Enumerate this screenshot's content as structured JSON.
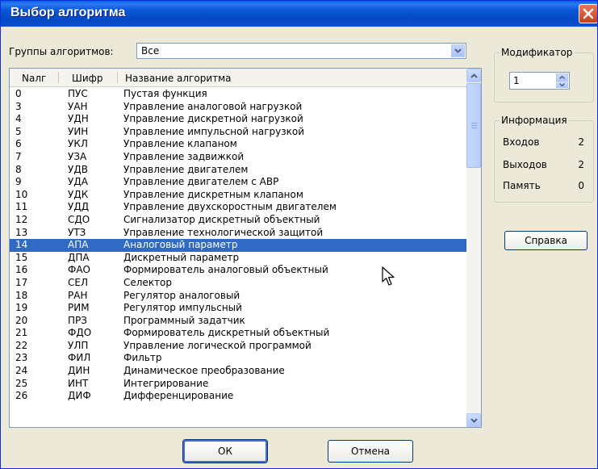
{
  "window": {
    "title": "Выбор алгоритма"
  },
  "groups": {
    "label": "Группы алгоритмов:",
    "selected": "Все"
  },
  "list": {
    "columns": [
      "Nалг",
      "Шифр",
      "Название алгоритма"
    ],
    "rows": [
      {
        "n": "0",
        "code": "ПУС",
        "name": "Пустая функция"
      },
      {
        "n": "3",
        "code": "УАН",
        "name": "Управление аналоговой нагрузкой"
      },
      {
        "n": "4",
        "code": "УДН",
        "name": "Управление дискретной нагрузкой"
      },
      {
        "n": "5",
        "code": "УИН",
        "name": "Управление импульсной нагрузкой"
      },
      {
        "n": "6",
        "code": "УКЛ",
        "name": "Управление клапаном"
      },
      {
        "n": "7",
        "code": "УЗА",
        "name": "Управление задвижкой"
      },
      {
        "n": "8",
        "code": "УДВ",
        "name": "Управление двигателем"
      },
      {
        "n": "9",
        "code": "УДА",
        "name": "Управление двигателем с АВР"
      },
      {
        "n": "10",
        "code": "УДК",
        "name": "Управление дискретным клапаном"
      },
      {
        "n": "11",
        "code": "УДД",
        "name": "Управление двухскоростным двигателем"
      },
      {
        "n": "12",
        "code": "СДО",
        "name": "Сигнализатор дискретный объектный"
      },
      {
        "n": "13",
        "code": "УТЗ",
        "name": "Управление технологической защитой"
      },
      {
        "n": "14",
        "code": "АПА",
        "name": "Аналоговый параметр"
      },
      {
        "n": "15",
        "code": "ДПА",
        "name": "Дискретный параметр"
      },
      {
        "n": "16",
        "code": "ФАО",
        "name": "Формирователь аналоговый объектный"
      },
      {
        "n": "17",
        "code": "СЕЛ",
        "name": "Селектор"
      },
      {
        "n": "18",
        "code": "РАН",
        "name": "Регулятор аналоговый"
      },
      {
        "n": "19",
        "code": "РИМ",
        "name": "Регулятор импульсный"
      },
      {
        "n": "20",
        "code": "ПРЗ",
        "name": "Программный задатчик"
      },
      {
        "n": "21",
        "code": "ФДО",
        "name": "Формирователь дискретный объектный"
      },
      {
        "n": "22",
        "code": "УЛП",
        "name": "Управление логической программой"
      },
      {
        "n": "23",
        "code": "ФИЛ",
        "name": "Фильтр"
      },
      {
        "n": "24",
        "code": "ДИН",
        "name": "Динамическое преобразование"
      },
      {
        "n": "25",
        "code": "ИНТ",
        "name": "Интегрирование"
      },
      {
        "n": "26",
        "code": "ДИФ",
        "name": "Дифференцирование"
      }
    ],
    "selected_n": "14"
  },
  "modifier": {
    "label": "Модификатор",
    "value": "1"
  },
  "info": {
    "label": "Информация",
    "inputs_label": "Входов",
    "inputs_value": "2",
    "outputs_label": "Выходов",
    "outputs_value": "2",
    "memory_label": "Память",
    "memory_value": "0"
  },
  "buttons": {
    "help": "Справка",
    "ok": "ОК",
    "cancel": "Отмена"
  },
  "colors": {
    "title_bar": "#0a58d8",
    "selection": "#316ac5",
    "dialog_bg": "#ece9d8"
  },
  "icons": {
    "close": "close-icon",
    "dropdown": "chevron-down-icon",
    "scroll_up": "arrow-up-icon",
    "scroll_down": "arrow-down-icon",
    "cursor": "mouse-pointer-icon"
  }
}
